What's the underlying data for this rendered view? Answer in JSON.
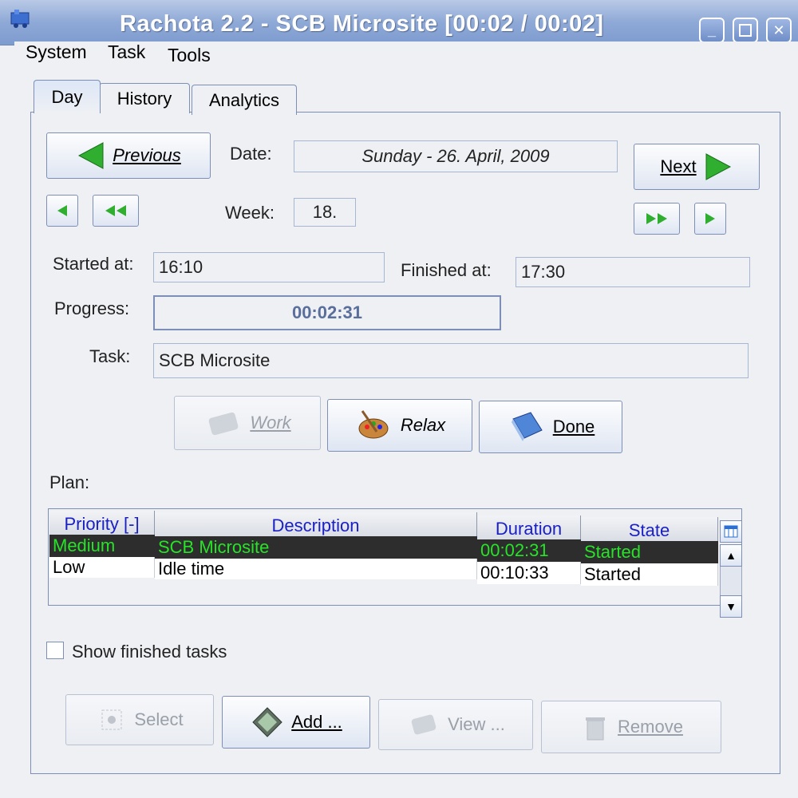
{
  "window": {
    "title": "Rachota 2.2 - SCB Microsite [00:02 / 00:02]"
  },
  "menu": [
    "System",
    "Task",
    "Tools"
  ],
  "tabs": [
    "Day",
    "History",
    "Analytics"
  ],
  "nav": {
    "previous_label": "Previous",
    "next_label": "Next"
  },
  "date": {
    "label": "Date:",
    "value": "Sunday - 26. April, 2009"
  },
  "week": {
    "label": "Week:",
    "value": "18."
  },
  "started": {
    "label": "Started at:",
    "value": "16:10"
  },
  "finished": {
    "label": "Finished at:",
    "value": "17:30"
  },
  "progress": {
    "label": "Progress:",
    "value": "00:02:31"
  },
  "task": {
    "label": "Task:",
    "value": "SCB Microsite"
  },
  "actions": {
    "work": "Work",
    "relax": "Relax",
    "done": "Done"
  },
  "plan": {
    "label": "Plan:",
    "columns": [
      "Priority [-]",
      "Description",
      "Duration",
      "State"
    ],
    "rows": [
      {
        "priority": "Medium",
        "description": "SCB Microsite",
        "duration": "00:02:31",
        "state": "Started",
        "selected": true
      },
      {
        "priority": "Low",
        "description": "Idle time",
        "duration": "00:10:33",
        "state": "Started",
        "selected": false
      }
    ]
  },
  "show_finished": {
    "label": "Show finished tasks",
    "checked": false
  },
  "bottom_buttons": {
    "select": "Select",
    "add": "Add ...",
    "view": "View ...",
    "remove": "Remove"
  },
  "colors": {
    "title_bar": "#8ea9d6",
    "selected_row_bg": "#2d2d2d",
    "selected_row_text": "#27e327",
    "header_text": "#1a20c4",
    "progress_text": "#5a6e9c"
  }
}
